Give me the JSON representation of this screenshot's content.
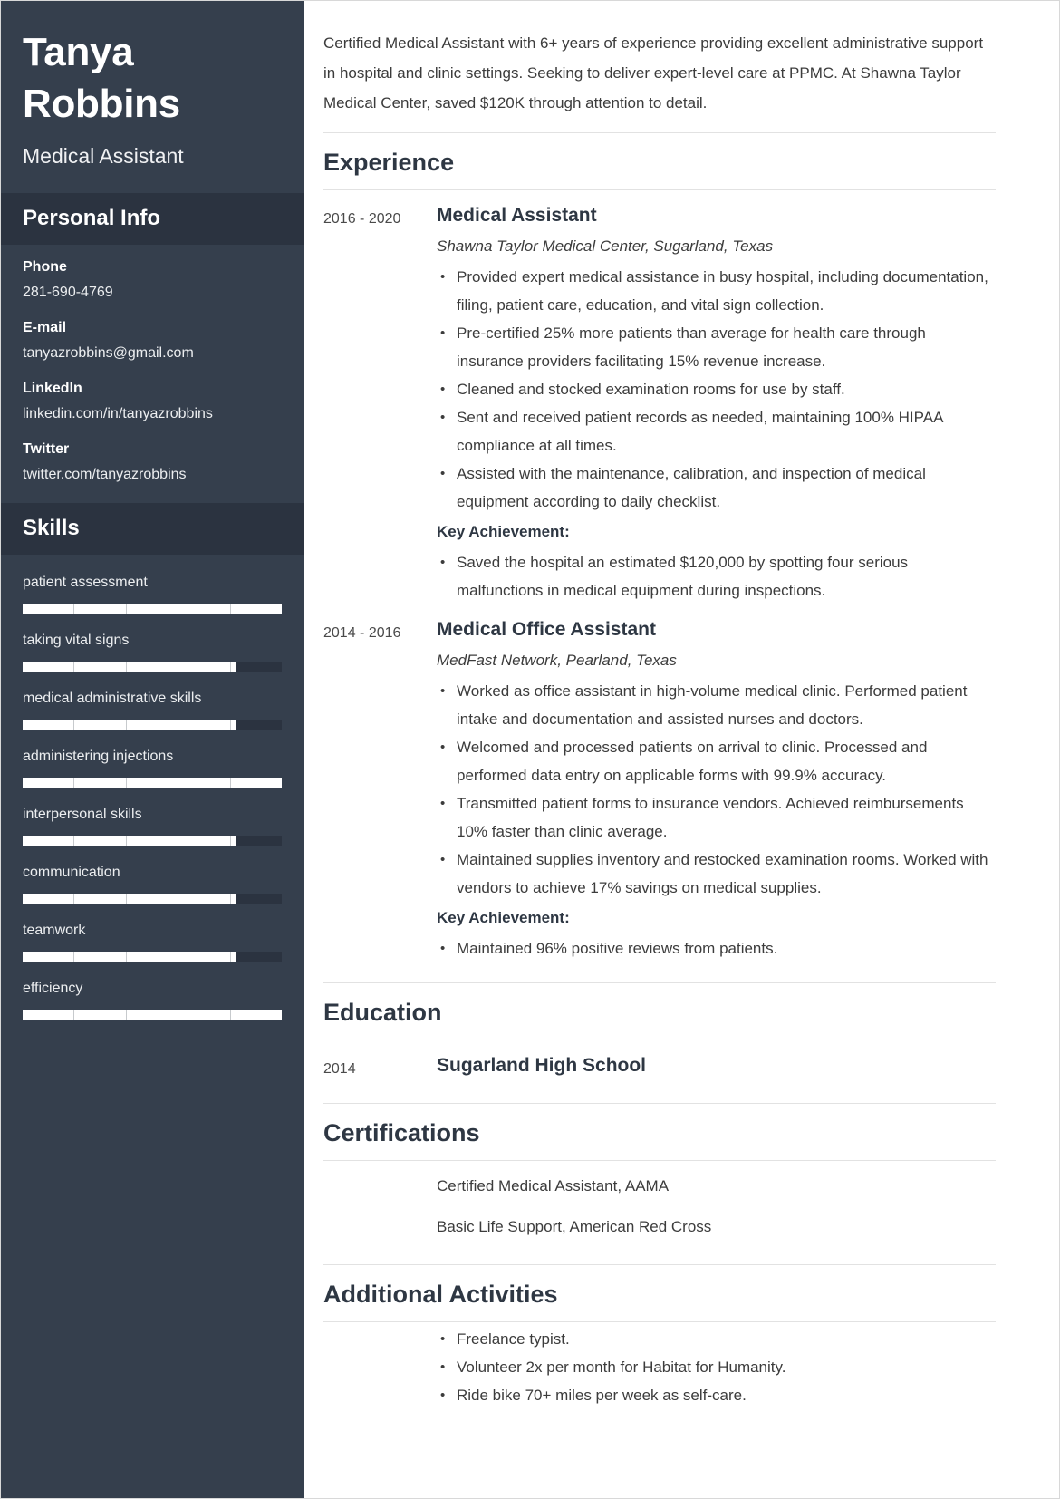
{
  "sidebar": {
    "name": "Tanya Robbins",
    "job_title": "Medical Assistant",
    "personal_info_heading": "Personal Info",
    "contacts": [
      {
        "label": "Phone",
        "value": "281-690-4769"
      },
      {
        "label": "E-mail",
        "value": "tanyazrobbins@gmail.com"
      },
      {
        "label": "LinkedIn",
        "value": "linkedin.com/in/tanyazrobbins"
      },
      {
        "label": "Twitter",
        "value": "twitter.com/tanyazrobbins"
      }
    ],
    "skills_heading": "Skills",
    "skills": [
      {
        "name": "patient assessment",
        "level": 100
      },
      {
        "name": "taking vital signs",
        "level": 82
      },
      {
        "name": "medical administrative skills",
        "level": 82
      },
      {
        "name": "administering injections",
        "level": 100
      },
      {
        "name": "interpersonal skills",
        "level": 82
      },
      {
        "name": "communication",
        "level": 82
      },
      {
        "name": "teamwork",
        "level": 82
      },
      {
        "name": "efficiency",
        "level": 100
      }
    ]
  },
  "main": {
    "summary": "Certified Medical Assistant with 6+ years of experience providing excellent administrative support in hospital and clinic settings. Seeking to deliver expert-level care at PPMC. At Shawna Taylor Medical Center, saved $120K through attention to detail.",
    "experience_heading": "Experience",
    "experience": [
      {
        "date": "2016 - 2020",
        "role": "Medical Assistant",
        "org": "Shawna Taylor Medical Center, Sugarland, Texas",
        "bullets": [
          "Provided expert medical assistance in busy hospital, including documentation, filing, patient care, education, and vital sign collection.",
          "Pre-certified 25% more patients than average for health care through insurance providers facilitating 15% revenue increase.",
          "Cleaned and stocked examination rooms for use by staff.",
          "Sent and received patient records as needed, maintaining 100% HIPAA compliance at all times.",
          "Assisted with the maintenance, calibration, and inspection of medical equipment according to daily checklist."
        ],
        "key_achievement_label": "Key Achievement:",
        "key_achievements": [
          "Saved the hospital an estimated $120,000 by spotting four serious malfunctions in medical equipment during inspections."
        ]
      },
      {
        "date": "2014 - 2016",
        "role": "Medical Office Assistant",
        "org": "MedFast Network, Pearland, Texas",
        "bullets": [
          "Worked as office assistant in high-volume medical clinic. Performed patient intake and documentation and assisted nurses and doctors.",
          "Welcomed and processed patients on arrival to clinic. Processed and performed data entry on applicable forms with 99.9% accuracy.",
          "Transmitted patient forms to insurance vendors. Achieved reimbursements 10% faster than clinic average.",
          "Maintained supplies inventory and restocked examination rooms. Worked with vendors to achieve 17% savings on medical supplies."
        ],
        "key_achievement_label": "Key Achievement:",
        "key_achievements": [
          "Maintained 96% positive reviews from patients."
        ]
      }
    ],
    "education_heading": "Education",
    "education": [
      {
        "date": "2014",
        "school": "Sugarland High School"
      }
    ],
    "certifications_heading": "Certifications",
    "certifications": [
      "Certified Medical Assistant, AAMA",
      "Basic Life Support, American Red Cross"
    ],
    "activities_heading": "Additional Activities",
    "activities": [
      "Freelance typist.",
      "Volunteer 2x per month for Habitat for Humanity.",
      "Ride bike 70+ miles per week as self-care."
    ]
  }
}
